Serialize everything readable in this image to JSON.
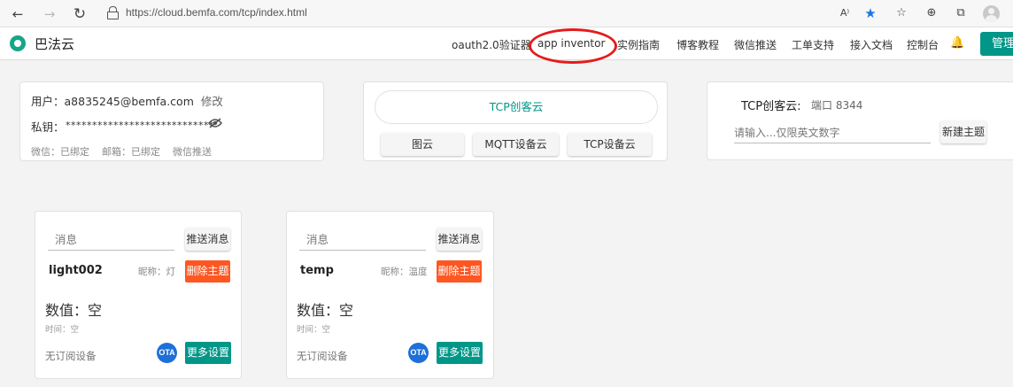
{
  "browser": {
    "url": "https://cloud.bemfa.com/tcp/index.html",
    "back_glyph": "←",
    "forward_glyph": "→",
    "reload_glyph": "↻",
    "read_aloud_glyph": "A⁾",
    "favorite_glyph": "★",
    "favorites_bar_glyph": "☆",
    "collections_glyph": "⊕",
    "extensions_glyph": "⧉",
    "icons": [
      "back-arrow-icon",
      "forward-arrow-icon",
      "reload-icon",
      "lock-icon",
      "read-aloud-icon",
      "favorite-star-icon",
      "favorites-icon",
      "collections-icon",
      "extensions-icon",
      "profile-avatar-icon"
    ]
  },
  "header": {
    "logo_text": "巴法云",
    "nav": [
      "oauth2.0验证器",
      "app inventor",
      "实例指南",
      "博客教程",
      "微信推送",
      "工单支持",
      "接入文档",
      "控制台"
    ],
    "bell_glyph": "🔔",
    "manage_label": "管理",
    "accent_color": "#009688",
    "highlight_color": "#e61b1b"
  },
  "account": {
    "user_label": "用户：",
    "email": "a8835245@bemfa.com",
    "edit_label": "修改",
    "key_label": "私钥：",
    "key_masked": "****************************",
    "wechat_status": "微信：已绑定",
    "email_status": "邮箱：已绑定",
    "wechat_push": "微信推送"
  },
  "cloud_switch": {
    "active": "TCP创客云",
    "options": [
      "图云",
      "MQTT设备云",
      "TCP设备云"
    ]
  },
  "tcp_panel": {
    "title": "TCP创客云:",
    "port_label": "端口 8344",
    "input_placeholder": "请输入...仅限英文数字",
    "create_label": "新建主题"
  },
  "devices": [
    {
      "message_placeholder": "消息",
      "push_label": "推送消息",
      "name": "light002",
      "nickname": "昵称：灯",
      "delete_label": "删除主题",
      "value_label": "数值：空",
      "time_label": "时间：空",
      "subscription": "无订阅设备",
      "ota_label": "OTA",
      "more_label": "更多设置"
    },
    {
      "message_placeholder": "消息",
      "push_label": "推送消息",
      "name": "temp",
      "nickname": "昵称：温度",
      "delete_label": "删除主题",
      "value_label": "数值：空",
      "time_label": "时间：空",
      "subscription": "无订阅设备",
      "ota_label": "OTA",
      "more_label": "更多设置"
    }
  ],
  "colors": {
    "danger": "#ff5722",
    "teal": "#009688",
    "ota_blue": "#1e6fd9"
  }
}
